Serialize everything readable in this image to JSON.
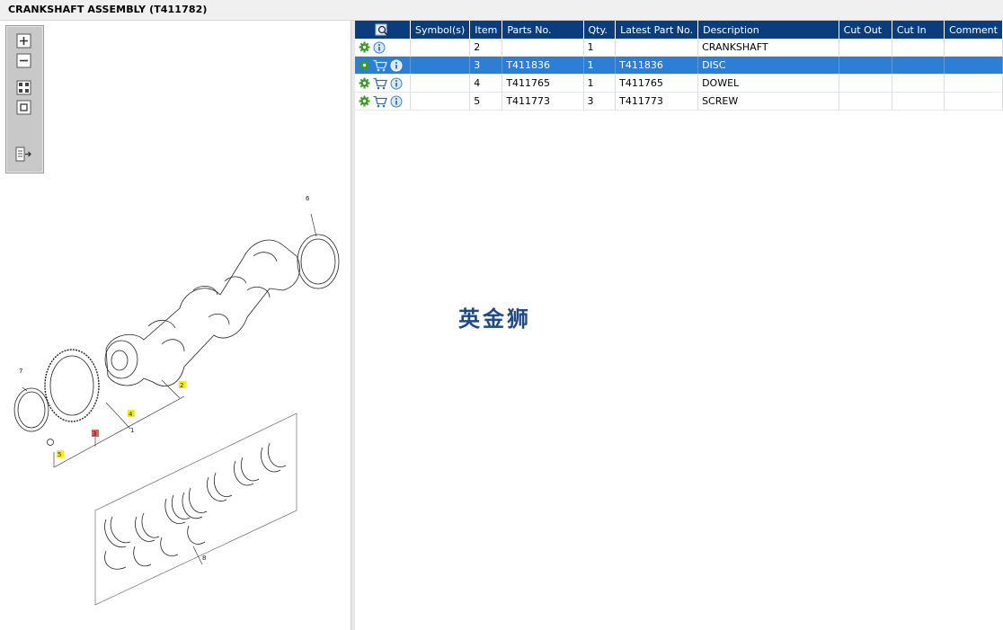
{
  "window": {
    "title": "CRANKSHAFT ASSEMBLY (T411782)"
  },
  "toolbox": {
    "tools": [
      {
        "name": "zoom-in-icon"
      },
      {
        "name": "zoom-out-icon"
      },
      {
        "name": "fit-page-icon"
      },
      {
        "name": "actual-size-icon"
      },
      {
        "name": "export-icon"
      }
    ]
  },
  "drawing": {
    "callouts": [
      "6",
      "7",
      "2",
      "4",
      "3",
      "1",
      "5",
      "8"
    ],
    "highlight_yellow": "#f5f000",
    "highlight_red": "#e06060"
  },
  "table": {
    "headers": [
      "",
      "Symbol(s)",
      "Item",
      "Parts No.",
      "Qty.",
      "Latest Part No.",
      "Description",
      "Cut Out",
      "Cut In",
      "Comment"
    ],
    "rows": [
      {
        "item": "2",
        "parts_no": "",
        "qty": "1",
        "latest": "",
        "desc": "CRANKSHAFT",
        "cart": false,
        "selected": false
      },
      {
        "item": "3",
        "parts_no": "T411836",
        "qty": "1",
        "latest": "T411836",
        "desc": "DISC",
        "cart": true,
        "selected": true
      },
      {
        "item": "4",
        "parts_no": "T411765",
        "qty": "1",
        "latest": "T411765",
        "desc": "DOWEL",
        "cart": true,
        "selected": false
      },
      {
        "item": "5",
        "parts_no": "T411773",
        "qty": "3",
        "latest": "T411773",
        "desc": "SCREW",
        "cart": true,
        "selected": false
      }
    ]
  },
  "watermark": {
    "text": "英金狮"
  },
  "colors": {
    "header_bg": "#0b3c7c",
    "selected_row": "#2d7fd6",
    "gear_green": "#3a9a2a",
    "info_blue": "#3b7fd0"
  }
}
